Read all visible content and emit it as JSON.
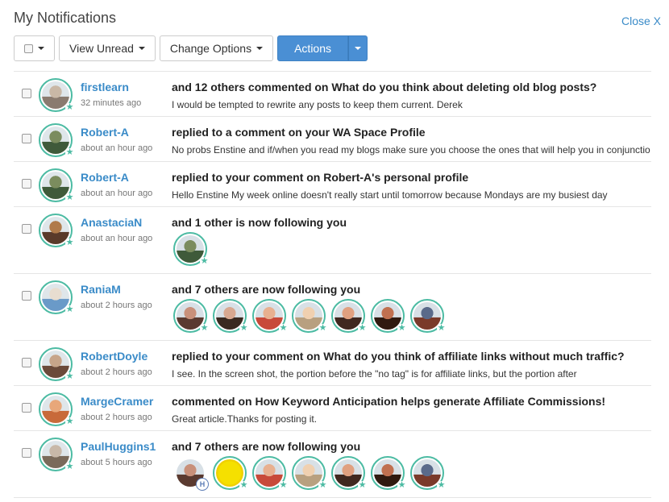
{
  "header": {
    "title": "My Notifications",
    "close_label": "Close X"
  },
  "toolbar": {
    "view_unread_label": "View Unread",
    "change_options_label": "Change Options",
    "actions_label": "Actions"
  },
  "notifications": [
    {
      "user": "firstlearn",
      "time": "32 minutes ago",
      "headline": "and 12 others commented on What do you think about deleting old blog posts?",
      "body": "I would be tempted to rewrite any posts to keep them current. Derek"
    },
    {
      "user": "Robert-A",
      "time": "about an hour ago",
      "headline": "replied to a comment on your WA Space Profile",
      "body": "No probs Enstine and if/when you read my blogs make sure you choose the ones that will help you in conjunctio"
    },
    {
      "user": "Robert-A",
      "time": "about an hour ago",
      "headline": "replied to your comment on Robert-A's personal profile",
      "body": "Hello Enstine My week online doesn't really start until tomorrow because Mondays are my busiest day"
    },
    {
      "user": "AnastaciaN",
      "time": "about an hour ago",
      "headline": "and 1 other is now following you",
      "followers": 1
    },
    {
      "user": "RaniaM",
      "time": "about 2 hours ago",
      "headline": "and 7 others are now following you",
      "followers": 7
    },
    {
      "user": "RobertDoyle",
      "time": "about 2 hours ago",
      "headline": "replied to your comment on What do you think of affiliate links without much traffic?",
      "body": "I see. In the screen shot, the portion before the \"no tag\" is for affiliate links, but the portion after"
    },
    {
      "user": "MargeCramer",
      "time": "about 2 hours ago",
      "headline": "commented on How Keyword Anticipation helps generate Affiliate Commissions!",
      "body": "Great article.Thanks for posting it."
    },
    {
      "user": "PaulHuggins1",
      "time": "about 5 hours ago",
      "headline": "and 7 others are now following you",
      "followers": 7
    }
  ],
  "colors": {
    "link": "#3a8bc8",
    "accent": "#4cbba3",
    "primary": "#4a8fd4"
  }
}
